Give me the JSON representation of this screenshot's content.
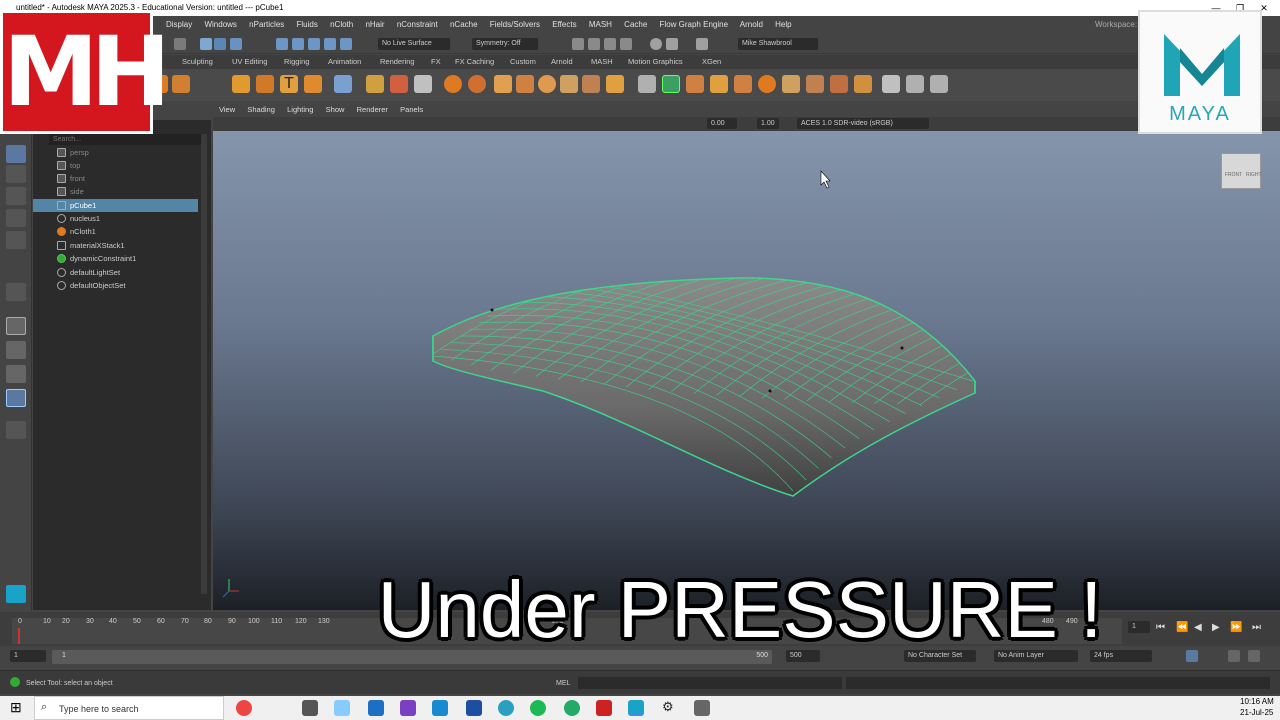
{
  "window": {
    "title": "untitled* - Autodesk MAYA 2025.3 - Educational Version: untitled  ---  pCube1",
    "controls": [
      "—",
      "❐",
      "✕"
    ]
  },
  "menubar": [
    "Display",
    "Windows",
    "nParticles",
    "Fluids",
    "nCloth",
    "nHair",
    "nConstraint",
    "nCache",
    "Fields/Solvers",
    "Effects",
    "MASH",
    "Cache",
    "Flow Graph Engine",
    "Arnold",
    "Help"
  ],
  "workspace_label": "Workspace:",
  "statusline": {
    "live_surface": "No Live Surface",
    "symmetry": "Symmetry: Off",
    "user": "Mike Shawbrool"
  },
  "shelf_tabs": [
    "ling",
    "Sculpting",
    "UV Editing",
    "Rigging",
    "Animation",
    "Rendering",
    "FX",
    "FX Caching",
    "Custom",
    "Arnold",
    "MASH",
    "Motion Graphics",
    "XGen"
  ],
  "outliner": {
    "search_placeholder": "Search...",
    "items": [
      "persp",
      "top",
      "front",
      "side",
      "pCube1",
      "nucleus1",
      "nCloth1",
      "materialXStack1",
      "dynamicConstraint1",
      "defaultLightSet",
      "defaultObjectSet"
    ],
    "selected": "pCube1"
  },
  "viewport": {
    "menu": [
      "View",
      "Shading",
      "Lighting",
      "Show",
      "Renderer",
      "Panels"
    ],
    "exposure": "0.00",
    "gamma": "1.00",
    "color_space": "ACES 1.0 SDR-video (sRGB)",
    "viewcube_labels": [
      "FRONT",
      "RIGHT"
    ],
    "wire_color": "#3dd68c"
  },
  "timeline": {
    "ticks": [
      "0",
      "10",
      "20",
      "30",
      "40",
      "50",
      "60",
      "70",
      "80",
      "90",
      "100",
      "110",
      "120",
      "130",
      "140",
      "250",
      "260",
      "480",
      "490"
    ],
    "current_frame": "1"
  },
  "range": {
    "start": "1",
    "inner_start": "1",
    "inner_end": "500",
    "end": "500",
    "character_set": "No Character Set",
    "anim_layer": "No Anim Layer",
    "fps": "24 fps"
  },
  "cmdline": {
    "lang": "MEL",
    "help": "Select Tool: select an object"
  },
  "taskbar": {
    "search_placeholder": "Type here to search",
    "time": "10:16 AM",
    "date": "21-Jul-25"
  },
  "overlay": {
    "logo_text": "MH",
    "maya_word": "MAYA",
    "title": "Under PRESSURE !"
  }
}
